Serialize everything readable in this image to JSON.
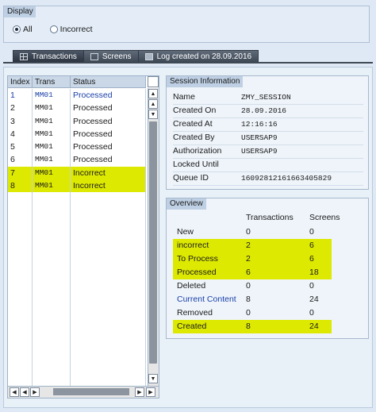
{
  "display": {
    "title": "Display",
    "options": [
      {
        "label": "All",
        "checked": true
      },
      {
        "label": "Incorrect",
        "checked": false
      }
    ]
  },
  "tabs": [
    {
      "label": "Transactions",
      "icon": "table-icon",
      "active": true
    },
    {
      "label": "Screens",
      "icon": "screen-icon",
      "active": false
    },
    {
      "label": "Log created on 28.09.2016",
      "icon": "log-icon",
      "active": false
    }
  ],
  "table": {
    "columns": [
      "Index",
      "Trans",
      "Status"
    ],
    "rows": [
      {
        "index": "1",
        "trans": "MM01",
        "status": "Processed",
        "highlight": false,
        "blue": true
      },
      {
        "index": "2",
        "trans": "MM01",
        "status": "Processed",
        "highlight": false,
        "blue": false
      },
      {
        "index": "3",
        "trans": "MM01",
        "status": "Processed",
        "highlight": false,
        "blue": false
      },
      {
        "index": "4",
        "trans": "MM01",
        "status": "Processed",
        "highlight": false,
        "blue": false
      },
      {
        "index": "5",
        "trans": "MM01",
        "status": "Processed",
        "highlight": false,
        "blue": false
      },
      {
        "index": "6",
        "trans": "MM01",
        "status": "Processed",
        "highlight": false,
        "blue": false
      },
      {
        "index": "7",
        "trans": "MM01",
        "status": "Incorrect",
        "highlight": true,
        "blue": false
      },
      {
        "index": "8",
        "trans": "MM01",
        "status": "Incorrect",
        "highlight": true,
        "blue": false
      }
    ]
  },
  "session": {
    "title": "Session Information",
    "fields": [
      {
        "label": "Name",
        "value": "ZMY_SESSION"
      },
      {
        "label": "Created On",
        "value": "28.09.2016"
      },
      {
        "label": "Created At",
        "value": "12:16:16"
      },
      {
        "label": "Created By",
        "value": "USERSAP9"
      },
      {
        "label": "Authorization",
        "value": "USERSAP9"
      },
      {
        "label": "Locked Until",
        "value": ""
      },
      {
        "label": "Queue ID",
        "value": "16092812161663405829"
      }
    ]
  },
  "overview": {
    "title": "Overview",
    "col_transactions": "Transactions",
    "col_screens": "Screens",
    "rows": [
      {
        "label": "New",
        "transactions": "0",
        "screens": "0",
        "highlight": false,
        "blue": false
      },
      {
        "label": "incorrect",
        "transactions": "2",
        "screens": "6",
        "highlight": true,
        "blue": false
      },
      {
        "label": "To Process",
        "transactions": "2",
        "screens": "6",
        "highlight": true,
        "blue": false
      },
      {
        "label": "Processed",
        "transactions": "6",
        "screens": "18",
        "highlight": true,
        "blue": false
      },
      {
        "label": "Deleted",
        "transactions": "0",
        "screens": "0",
        "highlight": false,
        "blue": false
      },
      {
        "label": "Current Content",
        "transactions": "8",
        "screens": "24",
        "highlight": false,
        "blue": true
      },
      {
        "label": "Removed",
        "transactions": "0",
        "screens": "0",
        "highlight": false,
        "blue": false
      },
      {
        "label": "Created",
        "transactions": "8",
        "screens": "24",
        "highlight": true,
        "blue": false
      }
    ]
  },
  "colors": {
    "highlight": "#dde900",
    "link_blue": "#1a3fa8",
    "tab_dark": "#3f4956"
  }
}
